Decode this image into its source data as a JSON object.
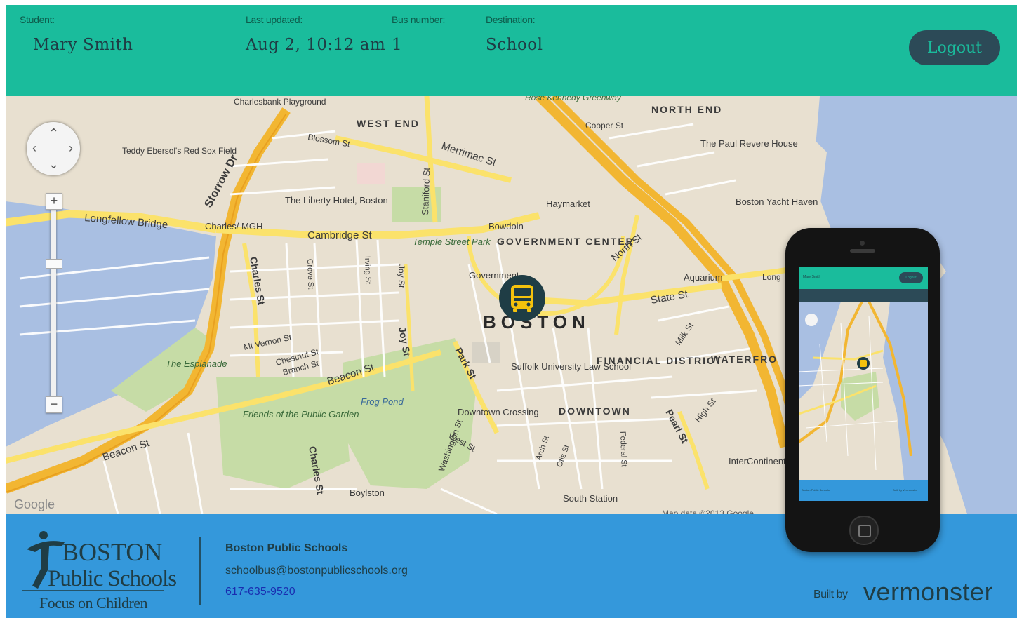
{
  "header": {
    "student_label": "Student:",
    "student_value": "Mary Smith",
    "updated_label": "Last updated:",
    "updated_value": "Aug 2, 10:12 am",
    "bus_label": "Bus number:",
    "bus_value": "1",
    "destination_label": "Destination:",
    "destination_value": "School",
    "logout_label": "Logout"
  },
  "map": {
    "google_mark": "Google",
    "credit": "Map data ©2013 Google",
    "labels": {
      "boston": "BOSTON",
      "west_end": "WEST END",
      "north_end": "NORTH END",
      "government_center": "GOVERNMENT CENTER",
      "financial_district": "FINANCIAL DISTRICT",
      "downtown": "DOWNTOWN",
      "waterfront": "WATERFRO",
      "longfellow": "Longfellow Bridge",
      "cambridge_st": "Cambridge St",
      "storrow": "Storrow Dr",
      "merrimac": "Merrimac St",
      "state_st": "State St",
      "beacon_st": "Beacon St",
      "beacon_st_2": "Beacon St",
      "frog_pond": "Frog Pond",
      "friends": "Friends of the Public Garden",
      "esplanade": "The Esplanade",
      "liberty": "The Liberty Hotel, Boston",
      "haymarket": "Haymarket",
      "bowdoin": "Bowdoin",
      "aquarium": "Aquarium",
      "paul_revere": "The Paul Revere House",
      "yacht": "Boston Yacht Haven",
      "suffolk": "Suffolk University Law School",
      "downtown_crossing": "Downtown Crossing",
      "south_station": "South Station",
      "boylston": "Boylston",
      "charles_mgh": "Charles/ MGH",
      "teddy": "Teddy Ebersol's Red Sox Field",
      "charlesbank": "Charlesbank Playground",
      "temple": "Temple Street Park",
      "intercontinental": "InterContinental Boston",
      "mt_vernon": "Mt Vernon St",
      "chestnut": "Chestnut St",
      "branch": "Branch St",
      "charles_st": "Charles St",
      "charles_st_2": "Charles St",
      "joy_st": "Joy St",
      "joy_st_2": "Joy St",
      "park_st": "Park St",
      "north_st": "North St",
      "pearl_st": "Pearl St",
      "high_st": "High St",
      "milk_st": "Milk St",
      "west_st": "West St",
      "washington_st": "Washington St",
      "staniford": "Staniford St",
      "blossom": "Blossom St",
      "grove": "Grove St",
      "irving": "Irving St",
      "cooper": "Cooper St",
      "government": "Government",
      "greenway": "Rose Kennedy Greenway",
      "long": "Long",
      "federal": "Federal St",
      "otis": "Otis St",
      "arch": "Arch St"
    }
  },
  "phone": {
    "header_name": "Mary Smith",
    "header_logout": "Logout",
    "footer_left": "Boston Public Schools",
    "footer_right": "Built by Vermonster"
  },
  "footer": {
    "logo_boston": "BOSTON",
    "logo_public_schools": "Public Schools",
    "logo_tagline": "Focus on Children",
    "org_name": "Boston Public Schools",
    "email": "schoolbus@bostonpublicschools.org",
    "phone": "617-635-9520",
    "built_by": "Built by",
    "vermonster": "vermonster"
  },
  "colors": {
    "header_bg": "#1abc9c",
    "footer_bg": "#3498db",
    "dark_navy": "#1f3d45",
    "map_land": "#e8e0d0",
    "map_water": "#a9bfe2",
    "map_park": "#c6dca6",
    "road_yellow": "#fbe26b",
    "highway_orange": "#f2b632"
  },
  "icons": {
    "bus": "bus-icon",
    "pan": "pan-control-icon",
    "zoom_in": "zoom-in-icon",
    "zoom_out": "zoom-out-icon",
    "logo_figure": "bps-figure-icon"
  }
}
